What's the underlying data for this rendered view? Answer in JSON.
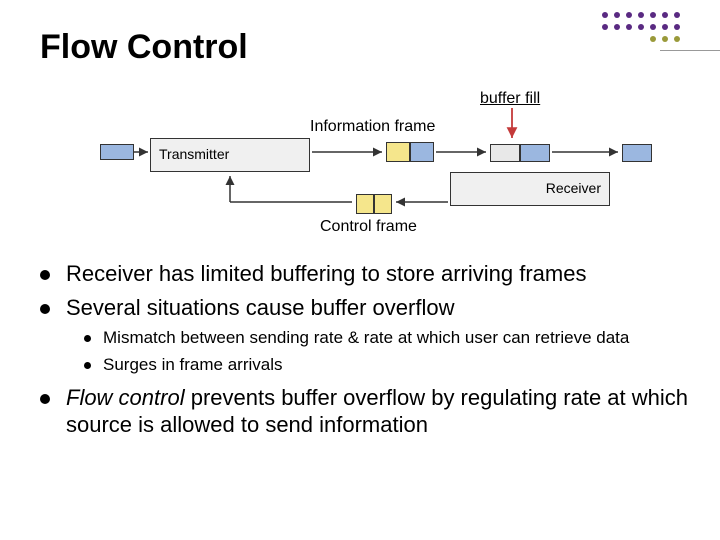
{
  "title": "Flow Control",
  "diagram": {
    "buffer_fill": "buffer fill",
    "information_frame": "Information frame",
    "control_frame": "Control frame",
    "transmitter": "Transmitter",
    "receiver": "Receiver"
  },
  "bullets": [
    "Receiver has limited buffering to store arriving frames",
    "Several situations cause buffer overflow"
  ],
  "sub_bullets": [
    "Mismatch between sending rate & rate at which user can retrieve data",
    "Surges in frame arrivals"
  ],
  "final_bullet_prefix": "Flow control",
  "final_bullet_rest": " prevents buffer overflow by regulating rate at which source is allowed to send information",
  "colors": {
    "packet_blue": "#9bb7e0",
    "packet_yellow": "#f5e68c",
    "packet_gray": "#e8e8e8",
    "arrow_red": "#c43a3a",
    "deco_purple": "#5a2a82",
    "deco_olive": "#9a9a3a"
  }
}
